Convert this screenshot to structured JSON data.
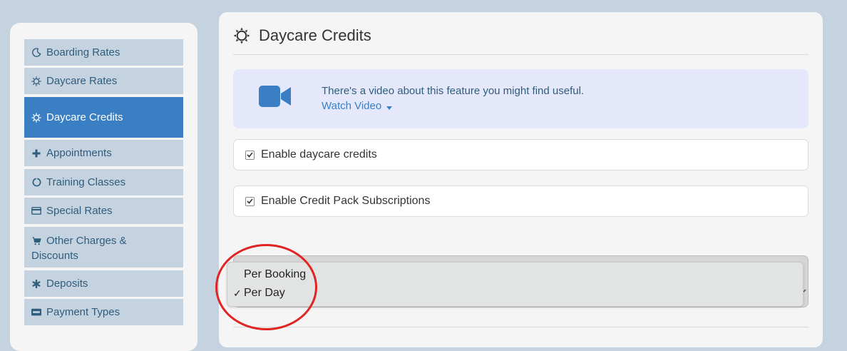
{
  "sidebar": {
    "items": [
      {
        "label": "Boarding Rates",
        "icon": "moon-icon"
      },
      {
        "label": "Daycare Rates",
        "icon": "sun-icon"
      },
      {
        "label": "Daycare Credits",
        "icon": "sun-icon",
        "active": true
      },
      {
        "label": "Appointments",
        "icon": "plus-icon"
      },
      {
        "label": "Training Classes",
        "icon": "circle-notch-icon"
      },
      {
        "label": "Special Rates",
        "icon": "credit-card-icon"
      },
      {
        "label": "Other Charges & Discounts",
        "icon": "cart-icon"
      },
      {
        "label": "Deposits",
        "icon": "asterisk-icon"
      },
      {
        "label": "Payment Types",
        "icon": "visa-card-icon"
      }
    ]
  },
  "main": {
    "title": "Daycare Credits",
    "title_icon": "sun-icon",
    "info": {
      "message": "There's a video about this feature you might find useful.",
      "link": "Watch Video",
      "icon": "video-camera-icon"
    },
    "checkboxes": [
      {
        "label": "Enable daycare credits",
        "checked": true
      },
      {
        "label": "Enable Credit Pack Subscriptions",
        "checked": true
      }
    ],
    "dropdown": {
      "options": [
        "Per Booking",
        "Per Day"
      ],
      "selected": "Per Day",
      "check_mark": "✓"
    }
  },
  "colors": {
    "background": "#c5d2df",
    "active": "#3a7fc4",
    "nav_text": "#2f5d7c",
    "info_bg": "#e5e8fb",
    "annotation": "#e02424"
  }
}
